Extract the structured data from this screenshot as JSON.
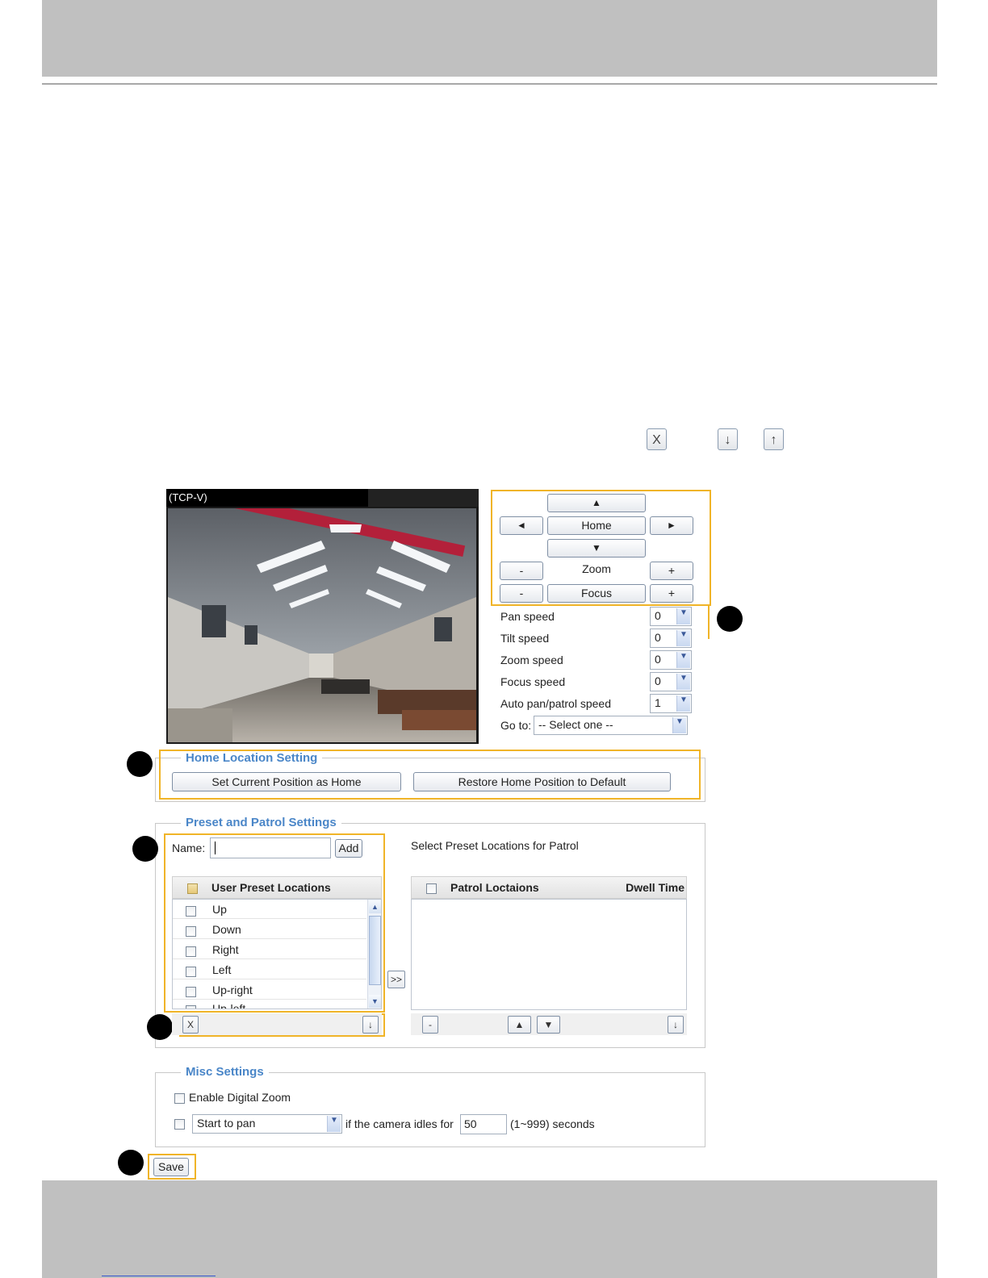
{
  "toolbar_icons": [
    {
      "name": "delete-icon",
      "glyph": "X"
    },
    {
      "name": "move-down-icon",
      "glyph": "↓"
    },
    {
      "name": "move-up-icon",
      "glyph": "↑"
    }
  ],
  "video": {
    "title": "(TCP-V)"
  },
  "ptz": {
    "up": "▲",
    "left": "◄",
    "home": "Home",
    "right": "►",
    "down": "▼",
    "zoom_minus": "-",
    "zoom_label": "Zoom",
    "zoom_plus": "+",
    "focus_minus": "-",
    "focus_label": "Focus",
    "focus_plus": "+"
  },
  "speeds": [
    {
      "label": "Pan speed",
      "value": "0"
    },
    {
      "label": "Tilt speed",
      "value": "0"
    },
    {
      "label": "Zoom speed",
      "value": "0"
    },
    {
      "label": "Focus speed",
      "value": "0"
    },
    {
      "label": "Auto pan/patrol speed",
      "value": "1"
    }
  ],
  "goto": {
    "label": "Go to:",
    "value": "-- Select one --"
  },
  "home_location": {
    "legend": "Home Location Setting",
    "set_button": "Set Current Position as Home",
    "restore_button": "Restore Home Position to Default"
  },
  "preset": {
    "legend": "Preset and Patrol Settings",
    "name_label": "Name:",
    "name_value": "",
    "add_button": "Add",
    "select_label": "Select Preset Locations for Patrol",
    "user_header": "User Preset Locations",
    "user_items": [
      "Up",
      "Down",
      "Right",
      "Left",
      "Up-right",
      "Up-left"
    ],
    "transfer_button": ">>",
    "patrol_header": "Patrol Loctaions",
    "dwell_header": "Dwell Time",
    "delete_btn": "X",
    "download_btn": "↓",
    "minus_btn": "-",
    "move_up_btn": "▲",
    "move_down_btn": "▼",
    "patrol_down_btn": "↓"
  },
  "misc": {
    "legend": "Misc Settings",
    "digital_zoom": "Enable Digital Zoom",
    "start_select": "Start to pan",
    "idle_text": "if the camera idles for",
    "idle_value": "50",
    "range_text": "(1~999) seconds"
  },
  "save_button": "Save",
  "colors": {
    "accent": "#f0b428",
    "legend": "#4a86c8",
    "bar": "#c0c0c0"
  }
}
